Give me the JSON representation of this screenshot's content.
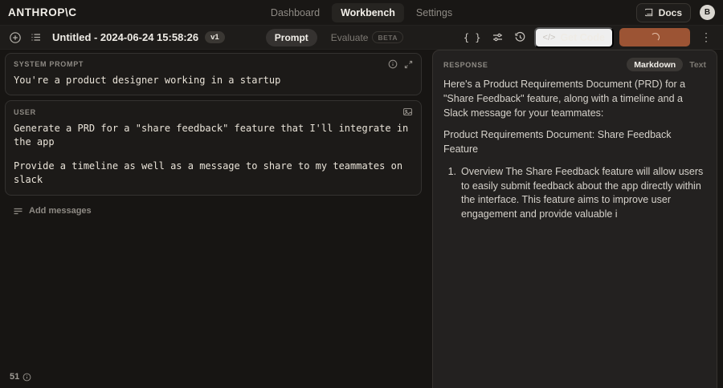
{
  "topnav": {
    "logo": "ANTHROP\\C",
    "items": [
      {
        "label": "Dashboard"
      },
      {
        "label": "Workbench"
      },
      {
        "label": "Settings"
      }
    ],
    "docs_label": "Docs",
    "avatar_initial": "B"
  },
  "toolbar": {
    "title": "Untitled - 2024-06-24 15:58:26",
    "version_badge": "v1",
    "tabs": [
      {
        "label": "Prompt"
      },
      {
        "label": "Evaluate",
        "badge": "BETA"
      }
    ],
    "icons": [
      "plus-circle",
      "prompt-list",
      "variables-braces",
      "settings-sliders",
      "history-clock",
      "code",
      "more-kebab"
    ],
    "get_code_label": "Get Code",
    "run_button_state": "loading",
    "accent_color": "#9c5434"
  },
  "prompt_panel": {
    "system": {
      "label": "SYSTEM PROMPT",
      "text": "You're a product designer working in a startup"
    },
    "user": {
      "label": "USER",
      "lines": [
        "Generate a PRD for a \"share feedback\" feature that I'll integrate in the app",
        "Provide a timeline as well as a message to share to my teammates on slack"
      ]
    },
    "add_messages_label": "Add messages",
    "token_count": "51"
  },
  "response_panel": {
    "label": "RESPONSE",
    "format_tabs": [
      {
        "label": "Markdown"
      },
      {
        "label": "Text"
      }
    ],
    "paragraphs": [
      "Here's a Product Requirements Document (PRD) for a \"Share Feedback\" feature, along with a timeline and a Slack message for your teammates:",
      "Product Requirements Document: Share Feedback Feature"
    ],
    "list_items": [
      {
        "marker": "1.",
        "text": "Overview The Share Feedback feature will allow users to easily submit feedback about the app directly within the interface. This feature aims to improve user engagement and provide valuable i"
      }
    ]
  }
}
